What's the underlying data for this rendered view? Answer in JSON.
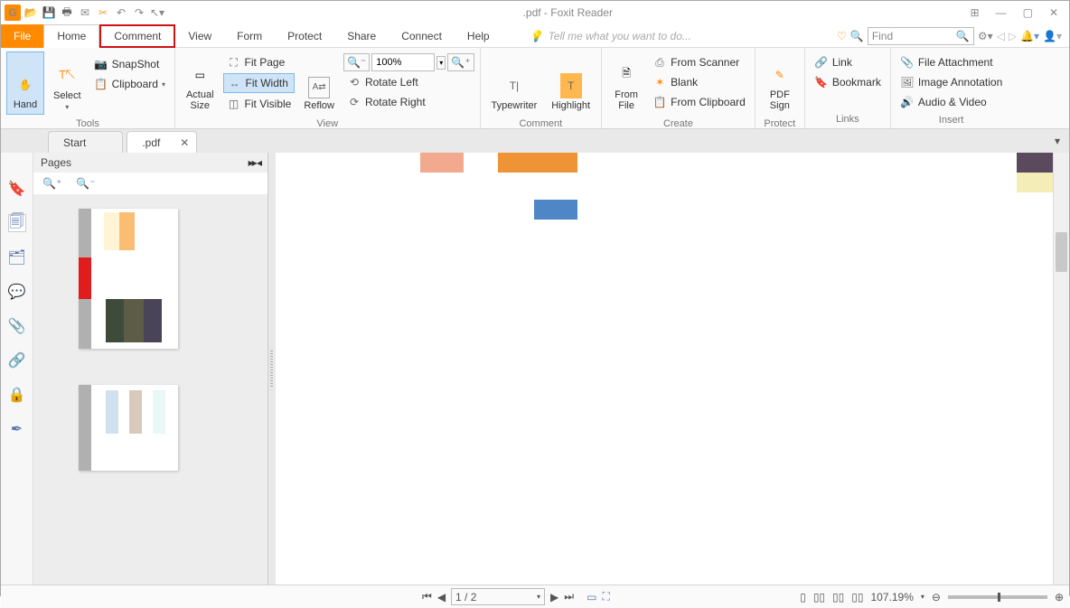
{
  "window": {
    "title": ".pdf - Foxit Reader"
  },
  "menu": {
    "file": "File",
    "home": "Home",
    "comment": "Comment",
    "view": "View",
    "form": "Form",
    "protect": "Protect",
    "share": "Share",
    "connect": "Connect",
    "help": "Help",
    "tellme": "Tell me what you want to do...",
    "find_placeholder": "Find"
  },
  "ribbon": {
    "tools": {
      "label": "Tools",
      "hand": "Hand",
      "select": "Select",
      "snapshot": "SnapShot",
      "clipboard": "Clipboard"
    },
    "view": {
      "label": "View",
      "actual_size": "Actual\nSize",
      "fit_page": "Fit Page",
      "fit_width": "Fit Width",
      "fit_visible": "Fit Visible",
      "reflow": "Reflow",
      "zoom_value": "100%",
      "rotate_left": "Rotate Left",
      "rotate_right": "Rotate Right"
    },
    "comment": {
      "label": "Comment",
      "typewriter": "Typewriter",
      "highlight": "Highlight"
    },
    "create": {
      "label": "Create",
      "from_file": "From\nFile",
      "from_scanner": "From Scanner",
      "blank": "Blank",
      "from_clipboard": "From Clipboard"
    },
    "protect": {
      "label": "Protect",
      "pdf_sign": "PDF\nSign"
    },
    "links": {
      "label": "Links",
      "link": "Link",
      "bookmark": "Bookmark"
    },
    "insert": {
      "label": "Insert",
      "file_attachment": "File Attachment",
      "image_annotation": "Image Annotation",
      "audio_video": "Audio & Video"
    }
  },
  "tabs": {
    "start": "Start",
    "doc": ".pdf"
  },
  "pages_panel": {
    "title": "Pages"
  },
  "status": {
    "page": "1 / 2",
    "zoom": "107.19%"
  }
}
